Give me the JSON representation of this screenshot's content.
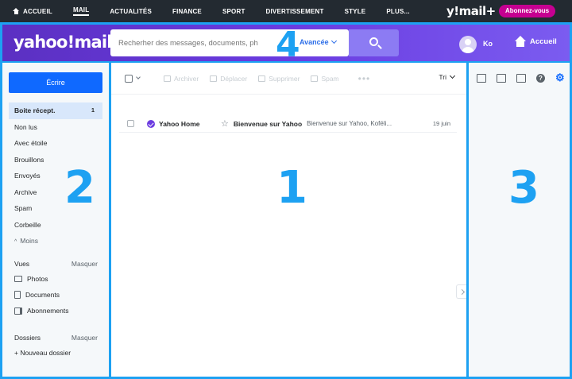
{
  "topnav": {
    "items": [
      "ACCUEIL",
      "MAIL",
      "ACTUALITÉS",
      "FINANCE",
      "SPORT",
      "DIVERTISSEMENT",
      "STYLE",
      "PLUS..."
    ],
    "logo": "y!mail+",
    "subscribe": "Abonnez-vous"
  },
  "header": {
    "brand": "yahoo!mail",
    "search_placeholder": "Recherher des messages, documents, ph",
    "advanced": "Avancée",
    "user": "Ko",
    "home": "Accueil"
  },
  "callouts": {
    "n1": "1",
    "n2": "2",
    "n3": "3",
    "n4": "4"
  },
  "sidebar": {
    "compose": "Écrire",
    "folders": [
      {
        "label": "Boite récept.",
        "count": "1"
      },
      {
        "label": "Non lus"
      },
      {
        "label": "Avec étoile"
      },
      {
        "label": "Brouillons"
      },
      {
        "label": "Envoyés"
      },
      {
        "label": "Archive"
      },
      {
        "label": "Spam"
      },
      {
        "label": "Corbeille"
      }
    ],
    "less": "Moins",
    "views_title": "Vues",
    "views_hide": "Masquer",
    "views": [
      "Photos",
      "Documents",
      "Abonnements"
    ],
    "folders_title": "Dossiers",
    "folders_hide": "Masquer",
    "new_folder": "+ Nouveau dossier"
  },
  "toolbar": {
    "archive": "Archiver",
    "move": "Déplacer",
    "delete": "Supprimer",
    "spam": "Spam",
    "more": "•••",
    "sort": "Tri"
  },
  "messages": [
    {
      "sender": "Yahoo Home",
      "subject": "Bienvenue sur Yahoo",
      "preview": "Bienvenue sur Yahoo, Koféli...",
      "date": "19 juin"
    }
  ]
}
